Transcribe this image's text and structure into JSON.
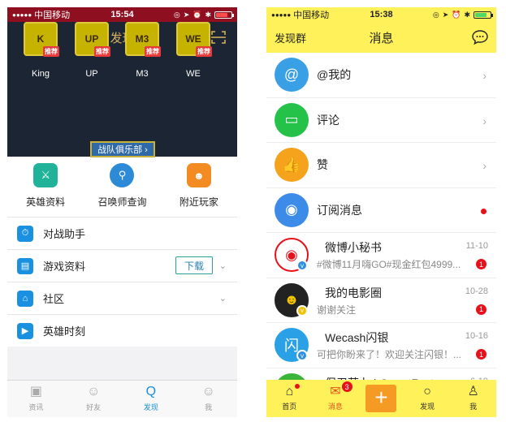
{
  "left": {
    "status": {
      "dots": "●●●●●",
      "carrier": "中国移动",
      "time": "15:54"
    },
    "nav": {
      "title": "发现"
    },
    "teams": [
      {
        "name": "King",
        "badge": "推荐",
        "logo_text": "K",
        "color": "#c6b300"
      },
      {
        "name": "UP",
        "badge": "推荐",
        "logo_text": "UP",
        "color": "#c6b300"
      },
      {
        "name": "M3",
        "badge": "推荐",
        "logo_text": "M3",
        "color": "#c6b300"
      },
      {
        "name": "WE",
        "badge": "推荐",
        "logo_text": "WE",
        "color": "#c6b300"
      }
    ],
    "club_button": "战队俱乐部 ›",
    "features": [
      {
        "label": "英雄资料",
        "icon": "hero-icon",
        "color": "#20b39a"
      },
      {
        "label": "召唤师查询",
        "icon": "summoner-search-icon",
        "color": "#2c8ad6"
      },
      {
        "label": "附近玩家",
        "icon": "nearby-players-icon",
        "color": "#f28b22"
      }
    ],
    "list": [
      {
        "label": "对战助手",
        "icon": "battle-assistant-icon"
      },
      {
        "label": "游戏资料",
        "icon": "game-info-icon",
        "button": "下载"
      },
      {
        "label": "社区",
        "icon": "community-icon"
      },
      {
        "label": "英雄时刻",
        "icon": "hero-moments-icon"
      }
    ],
    "tabs": [
      {
        "label": "资讯",
        "icon": "news-icon"
      },
      {
        "label": "好友",
        "icon": "friends-icon"
      },
      {
        "label": "发现",
        "icon": "discover-icon",
        "active": true
      },
      {
        "label": "我",
        "icon": "me-icon"
      }
    ]
  },
  "right": {
    "status": {
      "dots": "●●●●●",
      "carrier": "中国移动",
      "time": "15:38"
    },
    "nav": {
      "left": "发现群",
      "title": "消息"
    },
    "rows": [
      {
        "label": "@我的",
        "icon": "at-icon",
        "color": "#3aa0e6"
      },
      {
        "label": "评论",
        "icon": "comment-icon",
        "color": "#25c24a"
      },
      {
        "label": "赞",
        "icon": "like-icon",
        "color": "#f5a21d"
      },
      {
        "label": "订阅消息",
        "icon": "rss-icon",
        "color": "#3d8be8"
      }
    ],
    "messages": [
      {
        "name": "微博小秘书",
        "sub": "#微博11月嗨GO#现金红包4999...",
        "date": "11-10",
        "count": "1"
      },
      {
        "name": "我的电影圈",
        "sub": "谢谢关注",
        "date": "10-28",
        "count": "1"
      },
      {
        "name": "Wecash闪银",
        "sub": "可把你盼来了！欢迎关注闪银！...",
        "date": "10-16",
        "count": "1"
      },
      {
        "name": "保卫萝卜 | CarrotFantasy",
        "sub": "",
        "date": "6-19",
        "count": ""
      }
    ],
    "tabs": [
      {
        "label": "首页",
        "icon": "home-icon"
      },
      {
        "label": "消息",
        "icon": "mail-icon",
        "count": "3",
        "active": true
      },
      {
        "label": "+",
        "icon": "plus-icon"
      },
      {
        "label": "发现",
        "icon": "discover-icon"
      },
      {
        "label": "我",
        "icon": "profile-icon"
      }
    ]
  }
}
